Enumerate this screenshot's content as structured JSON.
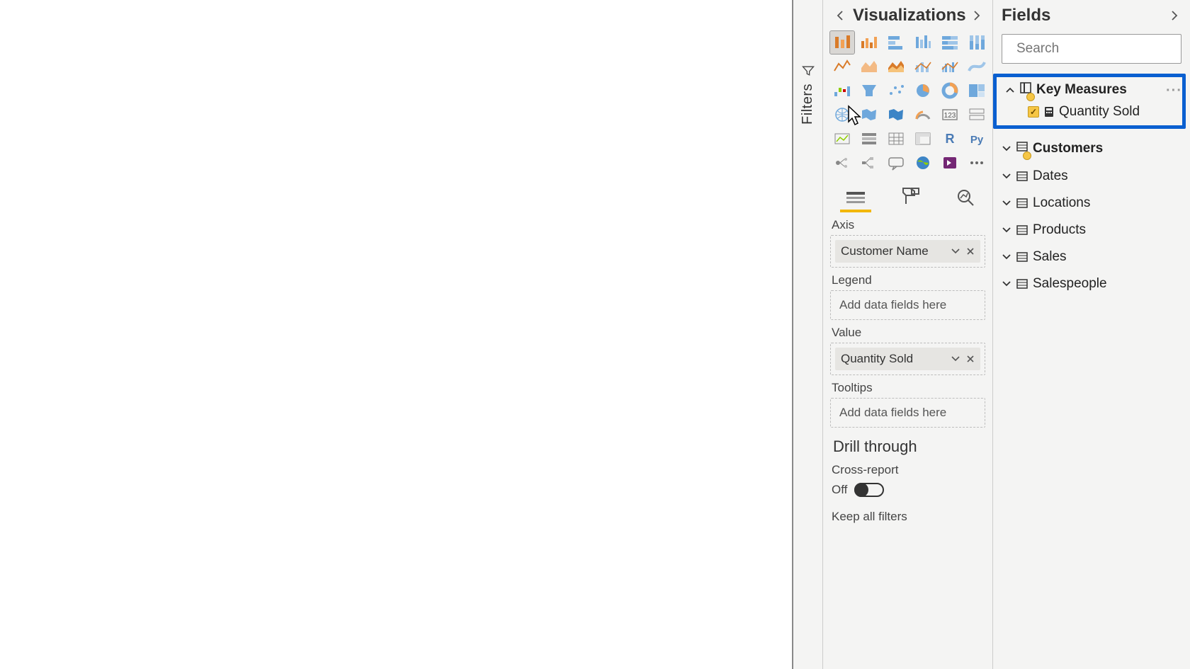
{
  "filters_tab": {
    "label": "Filters"
  },
  "viz_panel": {
    "title": "Visualizations",
    "wells": {
      "axis": {
        "label": "Axis",
        "chip": "Customer Name"
      },
      "legend": {
        "label": "Legend",
        "placeholder": "Add data fields here"
      },
      "value": {
        "label": "Value",
        "chip": "Quantity Sold"
      },
      "tooltips": {
        "label": "Tooltips",
        "placeholder": "Add data fields here"
      }
    },
    "drill": {
      "title": "Drill through",
      "cross_report_label": "Cross-report",
      "cross_report_state": "Off",
      "keep_all_filters_label": "Keep all filters"
    }
  },
  "fields_panel": {
    "title": "Fields",
    "search_placeholder": "Search",
    "tables": {
      "key_measures": {
        "label": "Key Measures",
        "children": [
          {
            "label": "Quantity Sold",
            "checked": true
          }
        ]
      },
      "customers": {
        "label": "Customers"
      },
      "dates": {
        "label": "Dates"
      },
      "locations": {
        "label": "Locations"
      },
      "products": {
        "label": "Products"
      },
      "sales": {
        "label": "Sales"
      },
      "salespeople": {
        "label": "Salespeople"
      }
    }
  }
}
